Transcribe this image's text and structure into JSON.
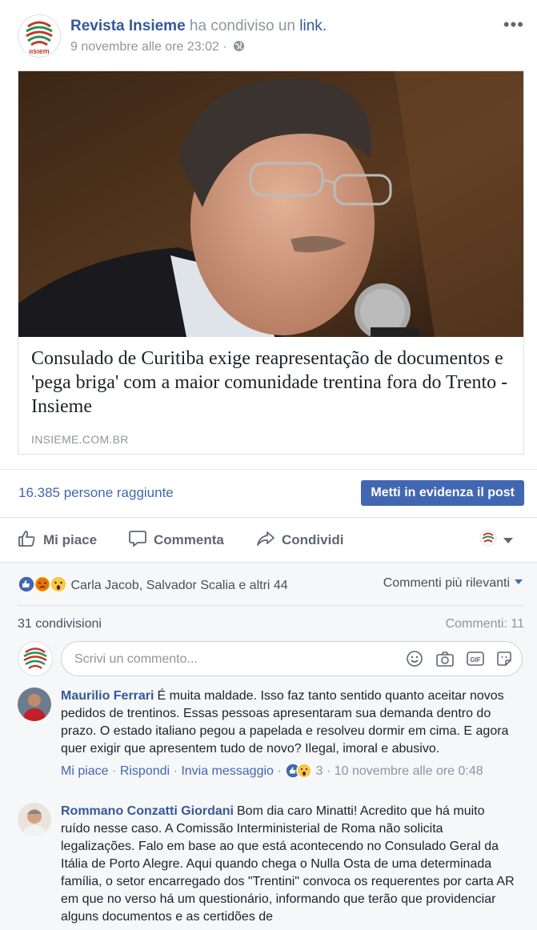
{
  "post": {
    "page_name": "Revista Insieme",
    "shared_text": "ha condiviso un",
    "link_word": "link.",
    "timestamp": "9 novembre alle ore 23:02",
    "separator": "·",
    "more_label": "•••"
  },
  "link_card": {
    "title": "Consulado de Curitiba exige reapresentação de documentos e 'pega briga' com a maior comunidade trentina fora do Trento - Insieme",
    "domain": "INSIEME.COM.BR",
    "logo_text": "ıısıem"
  },
  "insights": {
    "reach": "16.385 persone raggiunte",
    "boost_label": "Metti in evidenza il post"
  },
  "actions": {
    "like": "Mi piace",
    "comment": "Commenta",
    "share": "Condividi"
  },
  "feedback": {
    "reactions_text": "Carla Jacob, Salvador Scalia e altri 44",
    "sort_label": "Commenti più rilevanti",
    "shares": "31 condivisioni",
    "comments_count": "Commenti: 11"
  },
  "composer": {
    "placeholder": "Scrivi un commento..."
  },
  "comments": [
    {
      "author": "Maurilio Ferrari",
      "text": "É muita maldade. Isso faz tanto sentido quanto aceitar novos pedidos de trentinos. Essas pessoas apresentaram sua demanda dentro do prazo. O estado italiano pegou a papelada e resolveu dormir em cima. E agora quer exigir que apresentem tudo de novo? Ilegal, imoral e abusivo.",
      "like": "Mi piace",
      "reply": "Rispondi",
      "message": "Invia messaggio",
      "reaction_count": "3",
      "time": "10 novembre alle ore 0:48",
      "sep": "·"
    },
    {
      "author": "Rommano Conzatti Giordani",
      "text": "Bom dia caro Minatti! Acredito que há muito ruído nesse caso. A Comissão Interministerial de Roma não solicita legalizações. Falo em base ao que está acontecendo no Consulado Geral da Itália de Porto Alegre. Aqui quando chega o Nulla Osta de uma determinada família, o setor encarregado dos \"Trentini\" convoca os requerentes por carta AR em que no verso há um questionário, informando que terão que providenciar alguns documentos e as certidões de"
    }
  ],
  "colors": {
    "link_blue": "#365899",
    "button_blue": "#4267b2",
    "secondary_gray": "#90949c",
    "panel_gray": "#f6f7f9"
  }
}
